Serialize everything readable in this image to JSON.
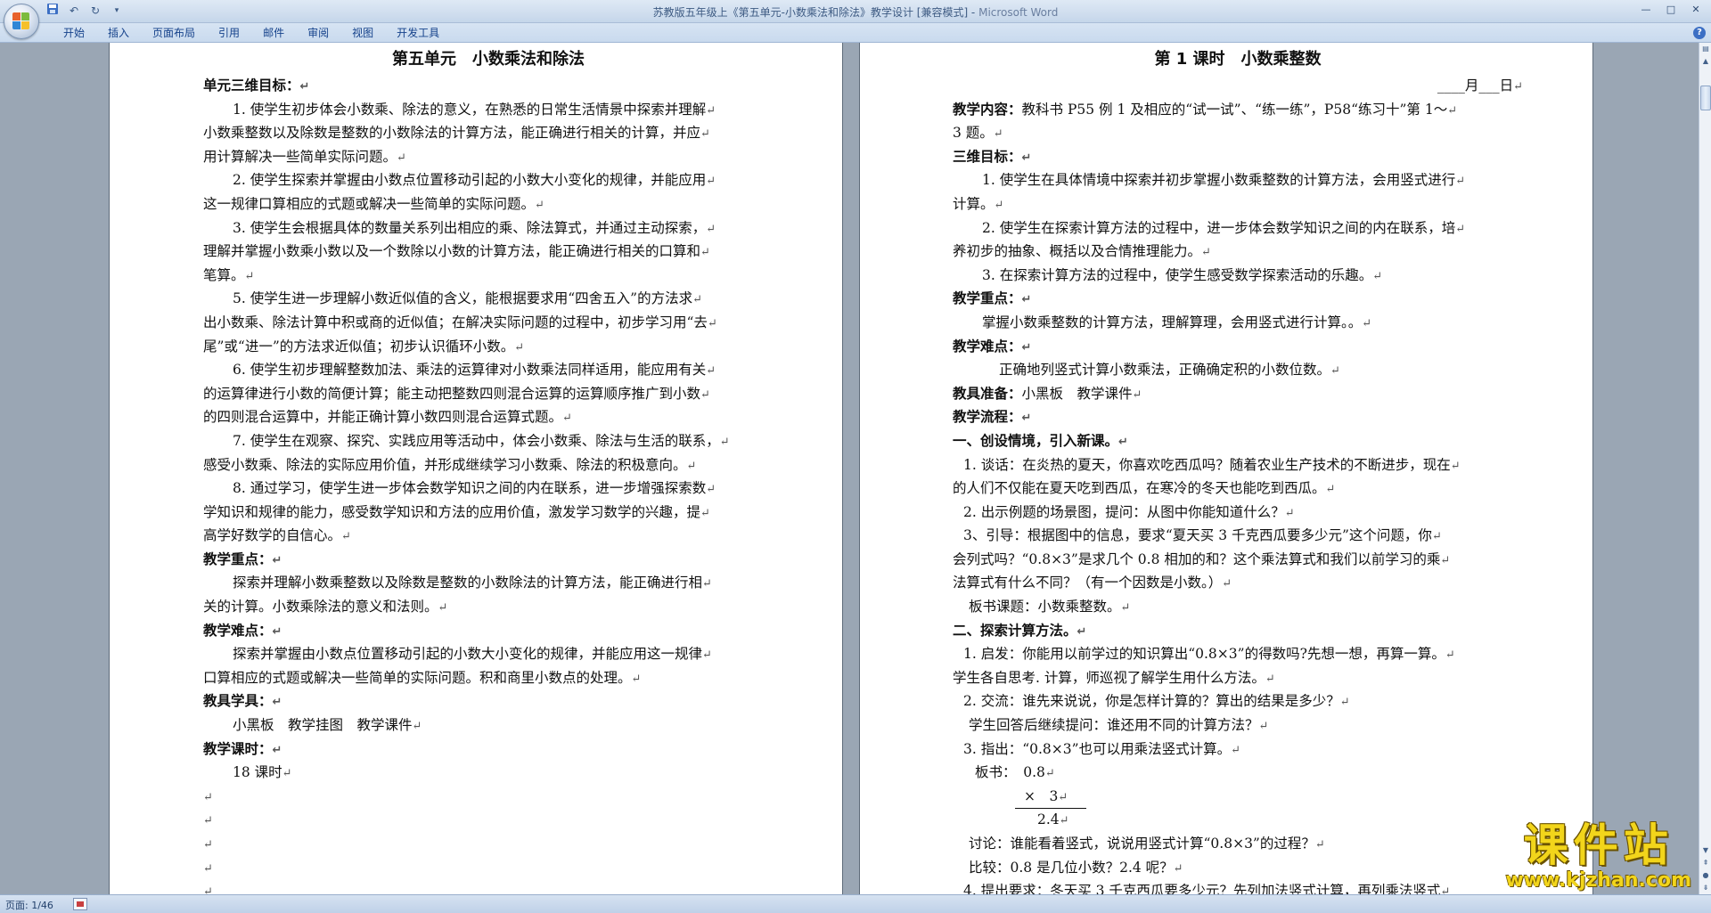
{
  "window": {
    "title": "苏教版五年级上《第五单元-小数乘法和除法》教学设计 [兼容模式] - ",
    "app_name": "Microsoft Word",
    "controls": [
      "—",
      "□",
      "✕"
    ]
  },
  "ribbon": {
    "tabs": [
      "开始",
      "插入",
      "页面布局",
      "引用",
      "邮件",
      "审阅",
      "视图",
      "开发工具"
    ]
  },
  "status": {
    "page": "页面: 1/46"
  },
  "watermark": {
    "title": "课件站",
    "url": "www.kjzhan.com"
  },
  "left_page": {
    "lines": [
      {
        "t": "第五单元　小数乘法和除法",
        "c": "title"
      },
      {
        "t": "单元三维目标：",
        "c": "hd"
      },
      {
        "t": "1. 使学生初步体会小数乘、除法的意义，在熟悉的日常生活情景中探索并理解",
        "c": "ind"
      },
      {
        "t": "小数乘整数以及除数是整数的小数除法的计算方法，能正确进行相关的计算，并应",
        "c": ""
      },
      {
        "t": "用计算解决一些简单实际问题。",
        "c": ""
      },
      {
        "t": "2. 使学生探索并掌握由小数点位置移动引起的小数大小变化的规律，并能应用",
        "c": "ind"
      },
      {
        "t": "这一规律口算相应的式题或解决一些简单的实际问题。",
        "c": ""
      },
      {
        "t": "3. 使学生会根据具体的数量关系列出相应的乘、除法算式，并通过主动探索，",
        "c": "ind"
      },
      {
        "t": "理解并掌握小数乘小数以及一个数除以小数的计算方法，能正确进行相关的口算和",
        "c": ""
      },
      {
        "t": "笔算。",
        "c": ""
      },
      {
        "t": "5. 使学生进一步理解小数近似值的含义，能根据要求用“四舍五入”的方法求",
        "c": "ind"
      },
      {
        "t": "出小数乘、除法计算中积或商的近似值；在解决实际问题的过程中，初步学习用“去",
        "c": ""
      },
      {
        "t": "尾”或“进一”的方法求近似值；初步认识循环小数。",
        "c": ""
      },
      {
        "t": "6. 使学生初步理解整数加法、乘法的运算律对小数乘法同样适用，能应用有关",
        "c": "ind"
      },
      {
        "t": "的运算律进行小数的简便计算；能主动把整数四则混合运算的运算顺序推广到小数",
        "c": ""
      },
      {
        "t": "的四则混合运算中，并能正确计算小数四则混合运算式题。",
        "c": ""
      },
      {
        "t": "7. 使学生在观察、探究、实践应用等活动中，体会小数乘、除法与生活的联系，",
        "c": "ind"
      },
      {
        "t": "感受小数乘、除法的实际应用价值，并形成继续学习小数乘、除法的积极意向。",
        "c": ""
      },
      {
        "t": "8. 通过学习，使学生进一步体会数学知识之间的内在联系，进一步增强探索数",
        "c": "ind"
      },
      {
        "t": "学知识和规律的能力，感受数学知识和方法的应用价值，激发学习数学的兴趣，提",
        "c": ""
      },
      {
        "t": "高学好数学的自信心。",
        "c": ""
      },
      {
        "t": "教学重点：",
        "c": "hd"
      },
      {
        "t": "探索并理解小数乘整数以及除数是整数的小数除法的计算方法，能正确进行相",
        "c": "ind"
      },
      {
        "t": "关的计算。小数乘除法的意义和法则。",
        "c": ""
      },
      {
        "t": "教学难点：",
        "c": "hd"
      },
      {
        "t": "探索并掌握由小数点位置移动引起的小数大小变化的规律，并能应用这一规律",
        "c": "ind"
      },
      {
        "t": "口算相应的式题或解决一些简单的实际问题。积和商里小数点的处理。",
        "c": ""
      },
      {
        "t": "教具学具：",
        "c": "hd"
      },
      {
        "t": "小黑板　教学挂图　教学课件",
        "c": "ind"
      },
      {
        "t": "教学课时：",
        "c": "hd"
      },
      {
        "t": "18 课时",
        "c": "ind"
      },
      {
        "t": "",
        "c": ""
      },
      {
        "t": "",
        "c": ""
      },
      {
        "t": "",
        "c": ""
      },
      {
        "t": "",
        "c": ""
      },
      {
        "t": "",
        "c": ""
      }
    ]
  },
  "right_page": {
    "lines": [
      {
        "t": "第 1 课时　小数乘整数",
        "c": "title"
      },
      {
        "t": "____月___日",
        "c": "right-al"
      },
      {
        "t": "教学内容：教科书 P55 例 1 及相应的“试一试”、“练一练”，P58“练习十”第 1～",
        "c": "mixed",
        "b": "教学内容："
      },
      {
        "t": "3 题。",
        "c": ""
      },
      {
        "t": "三维目标：",
        "c": "hd"
      },
      {
        "t": "1. 使学生在具体情境中探索并初步掌握小数乘整数的计算方法，会用竖式进行",
        "c": "ind"
      },
      {
        "t": "计算。",
        "c": ""
      },
      {
        "t": "2. 使学生在探索计算方法的过程中，进一步体会数学知识之间的内在联系，培",
        "c": "ind"
      },
      {
        "t": "养初步的抽象、概括以及合情推理能力。",
        "c": ""
      },
      {
        "t": "3. 在探索计算方法的过程中，使学生感受数学探索活动的乐趣。",
        "c": "ind"
      },
      {
        "t": "教学重点：",
        "c": "hd"
      },
      {
        "t": "掌握小数乘整数的计算方法，理解算理，会用竖式进行计算。。",
        "c": "ind"
      },
      {
        "t": "教学难点：",
        "c": "hd"
      },
      {
        "t": "正确地列竖式计算小数乘法，正确确定积的小数位数。",
        "c": "ind4"
      },
      {
        "t": "教具准备：小黑板　教学课件",
        "c": "mixed",
        "b": "教具准备："
      },
      {
        "t": "教学流程：",
        "c": "hd"
      },
      {
        "t": "一、创设情境，引入新课。",
        "c": "hd"
      },
      {
        "t": "1. 谈话：在炎热的夏天，你喜欢吃西瓜吗？随着农业生产技术的不断进步，现在",
        "c": "ind3"
      },
      {
        "t": "的人们不仅能在夏天吃到西瓜，在寒冷的冬天也能吃到西瓜。",
        "c": ""
      },
      {
        "t": "2. 出示例题的场景图，提问：从图中你能知道什么？",
        "c": "ind3"
      },
      {
        "t": "3、引导：根据图中的信息，要求“夏天买 3 千克西瓜要多少元”这个问题，你",
        "c": "ind3"
      },
      {
        "t": "会列式吗？“0.8×3”是求几个 0.8 相加的和？这个乘法算式和我们以前学习的乘",
        "c": ""
      },
      {
        "t": "法算式有什么不同？（有一个因数是小数。）",
        "c": ""
      },
      {
        "t": "板书课题：小数乘整数。",
        "c": "ind2"
      },
      {
        "t": "二、探索计算方法。",
        "c": "hd"
      },
      {
        "t": "1. 启发：你能用以前学过的知识算出“0.8×3”的得数吗?先想一想，再算一算。",
        "c": "ind3"
      },
      {
        "t": "学生各自思考. 计算，师巡视了解学生用什么方法。",
        "c": ""
      },
      {
        "t": "2. 交流：谁先来说说，你是怎样计算的？算出的结果是多少？",
        "c": "ind3"
      },
      {
        "t": "学生回答后继续提问：谁还用不同的计算方法？",
        "c": "ind2"
      },
      {
        "t": "3. 指出：“0.8×3”也可以用乘法竖式计算。",
        "c": "ind3"
      },
      {
        "t": "板书：　0.8",
        "c": "calc1"
      },
      {
        "t": "×　3",
        "c": "calc2"
      },
      {
        "t": "2.4",
        "c": "calc3"
      },
      {
        "t": "讨论：谁能看着竖式，说说用竖式计算“0.8×3”的过程？",
        "c": "ind2"
      },
      {
        "t": "比较：0.8 是几位小数？2.4 呢？",
        "c": "ind2"
      },
      {
        "t": "4. 提出要求：冬天买 3 千克西瓜要多少元？先列加法竖式计算，再列乘法竖式",
        "c": "ind3"
      }
    ]
  }
}
